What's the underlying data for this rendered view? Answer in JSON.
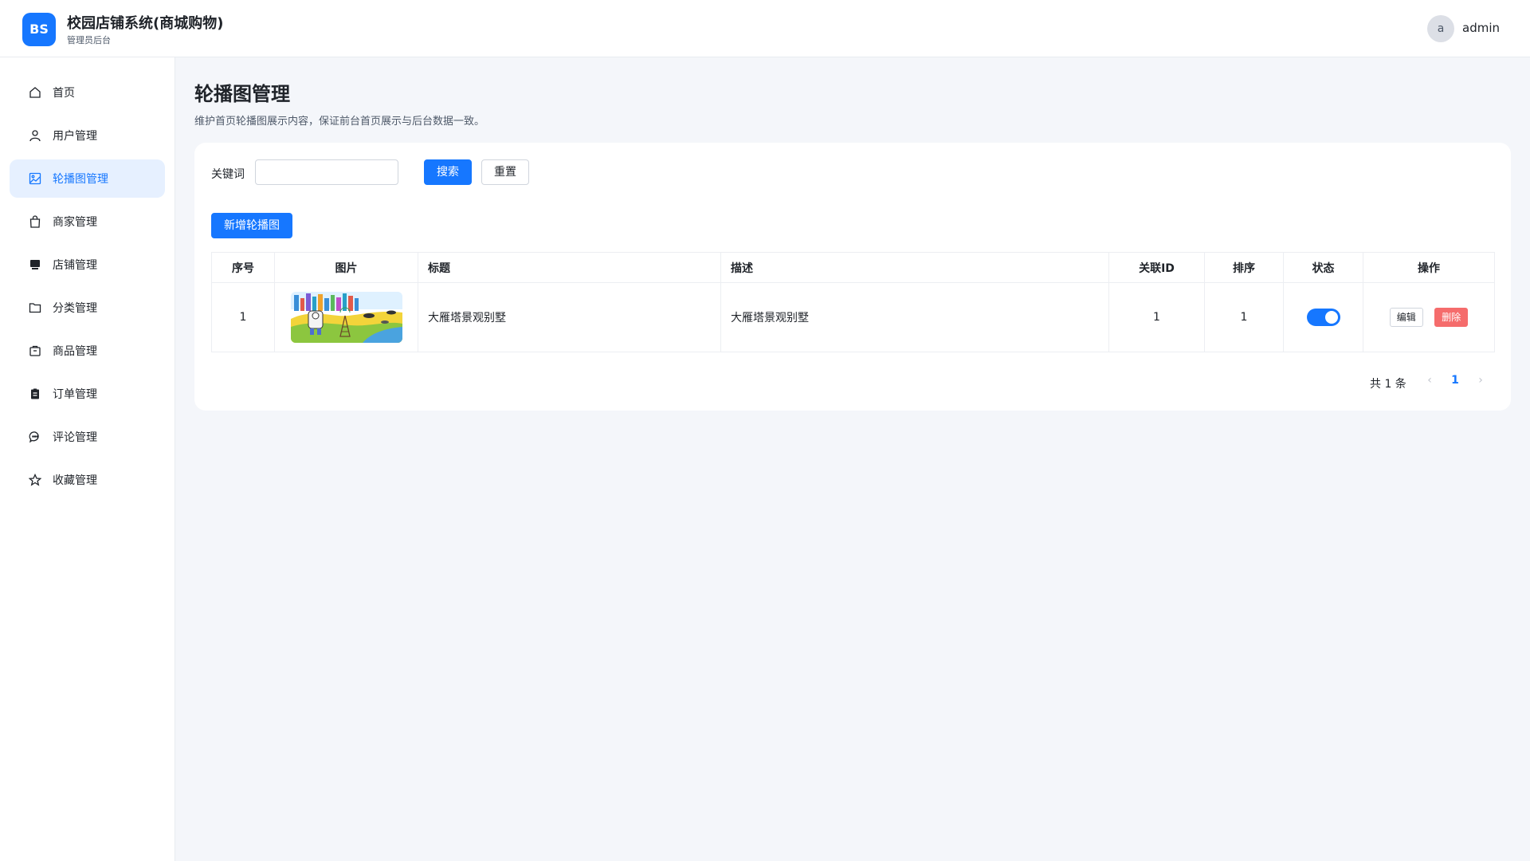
{
  "header": {
    "logo": "BS",
    "title": "校园店铺系统(商城购物)",
    "subtitle": "管理员后台",
    "user_initial": "a",
    "user_name": "admin"
  },
  "sidebar": {
    "items": [
      {
        "label": "首页",
        "icon": "home-icon"
      },
      {
        "label": "用户管理",
        "icon": "user-icon"
      },
      {
        "label": "轮播图管理",
        "icon": "image-icon",
        "active": true
      },
      {
        "label": "商家管理",
        "icon": "shopping-bag-icon"
      },
      {
        "label": "店铺管理",
        "icon": "store-icon"
      },
      {
        "label": "分类管理",
        "icon": "folder-icon"
      },
      {
        "label": "商品管理",
        "icon": "box-icon"
      },
      {
        "label": "订单管理",
        "icon": "clipboard-icon"
      },
      {
        "label": "评论管理",
        "icon": "chat-icon"
      },
      {
        "label": "收藏管理",
        "icon": "star-icon"
      }
    ]
  },
  "main": {
    "title": "轮播图管理",
    "description": "维护首页轮播图展示内容，保证前台首页展示与后台数据一致。",
    "filter": {
      "keyword_label": "关键词",
      "keyword_value": "",
      "search_label": "搜索",
      "reset_label": "重置"
    },
    "add_label": "新增轮播图",
    "table": {
      "columns": [
        "序号",
        "图片",
        "标题",
        "描述",
        "关联ID",
        "排序",
        "状态",
        "操作"
      ],
      "rows": [
        {
          "index": "1",
          "image": "banner-thumbnail",
          "title": "大雁塔景观别墅",
          "description": "大雁塔景观别墅",
          "related_id": "1",
          "sort": "1",
          "enabled": true,
          "edit_label": "编辑",
          "delete_label": "删除"
        }
      ]
    },
    "pagination": {
      "total_text": "共 1 条",
      "current_page": "1"
    }
  },
  "colors": {
    "primary": "#1677ff",
    "danger": "#f56c6c",
    "background": "#f4f6fa"
  }
}
